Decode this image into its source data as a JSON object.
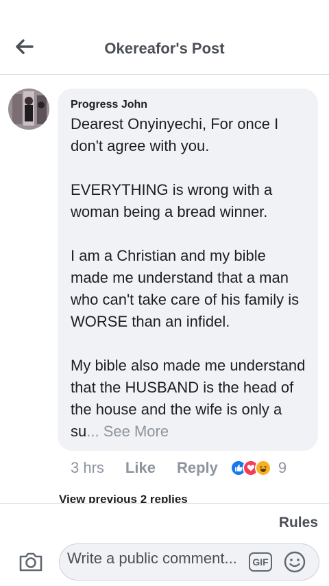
{
  "header": {
    "title": "Okereafor's Post"
  },
  "comment": {
    "author": "Progress John",
    "text": "Dearest Onyinyechi, For once I don't agree with you.\n\nEVERYTHING is wrong with a woman being a bread winner.\n\nI am a Christian and my bible made me understand that a man who can't take care of his family is WORSE than an infidel.\n\nMy bible also made me understand that the HUSBAND is the head of the  house and the wife is only a su",
    "see_more": "... See More",
    "time": "3 hrs",
    "like_label": "Like",
    "reply_label": "Reply",
    "reaction_count": "9",
    "reactions": [
      "like-icon",
      "love-icon",
      "haha-icon"
    ]
  },
  "replies": {
    "view_previous": "View previous 2 replies"
  },
  "rules_label": "Rules",
  "composer": {
    "placeholder": "Write a public comment...",
    "gif_label": "GIF"
  },
  "colors": {
    "accent": "#1877f2",
    "love": "#f33e58",
    "haha": "#f7b125",
    "muted": "#8d949e",
    "bubble": "#f0f2f5"
  }
}
